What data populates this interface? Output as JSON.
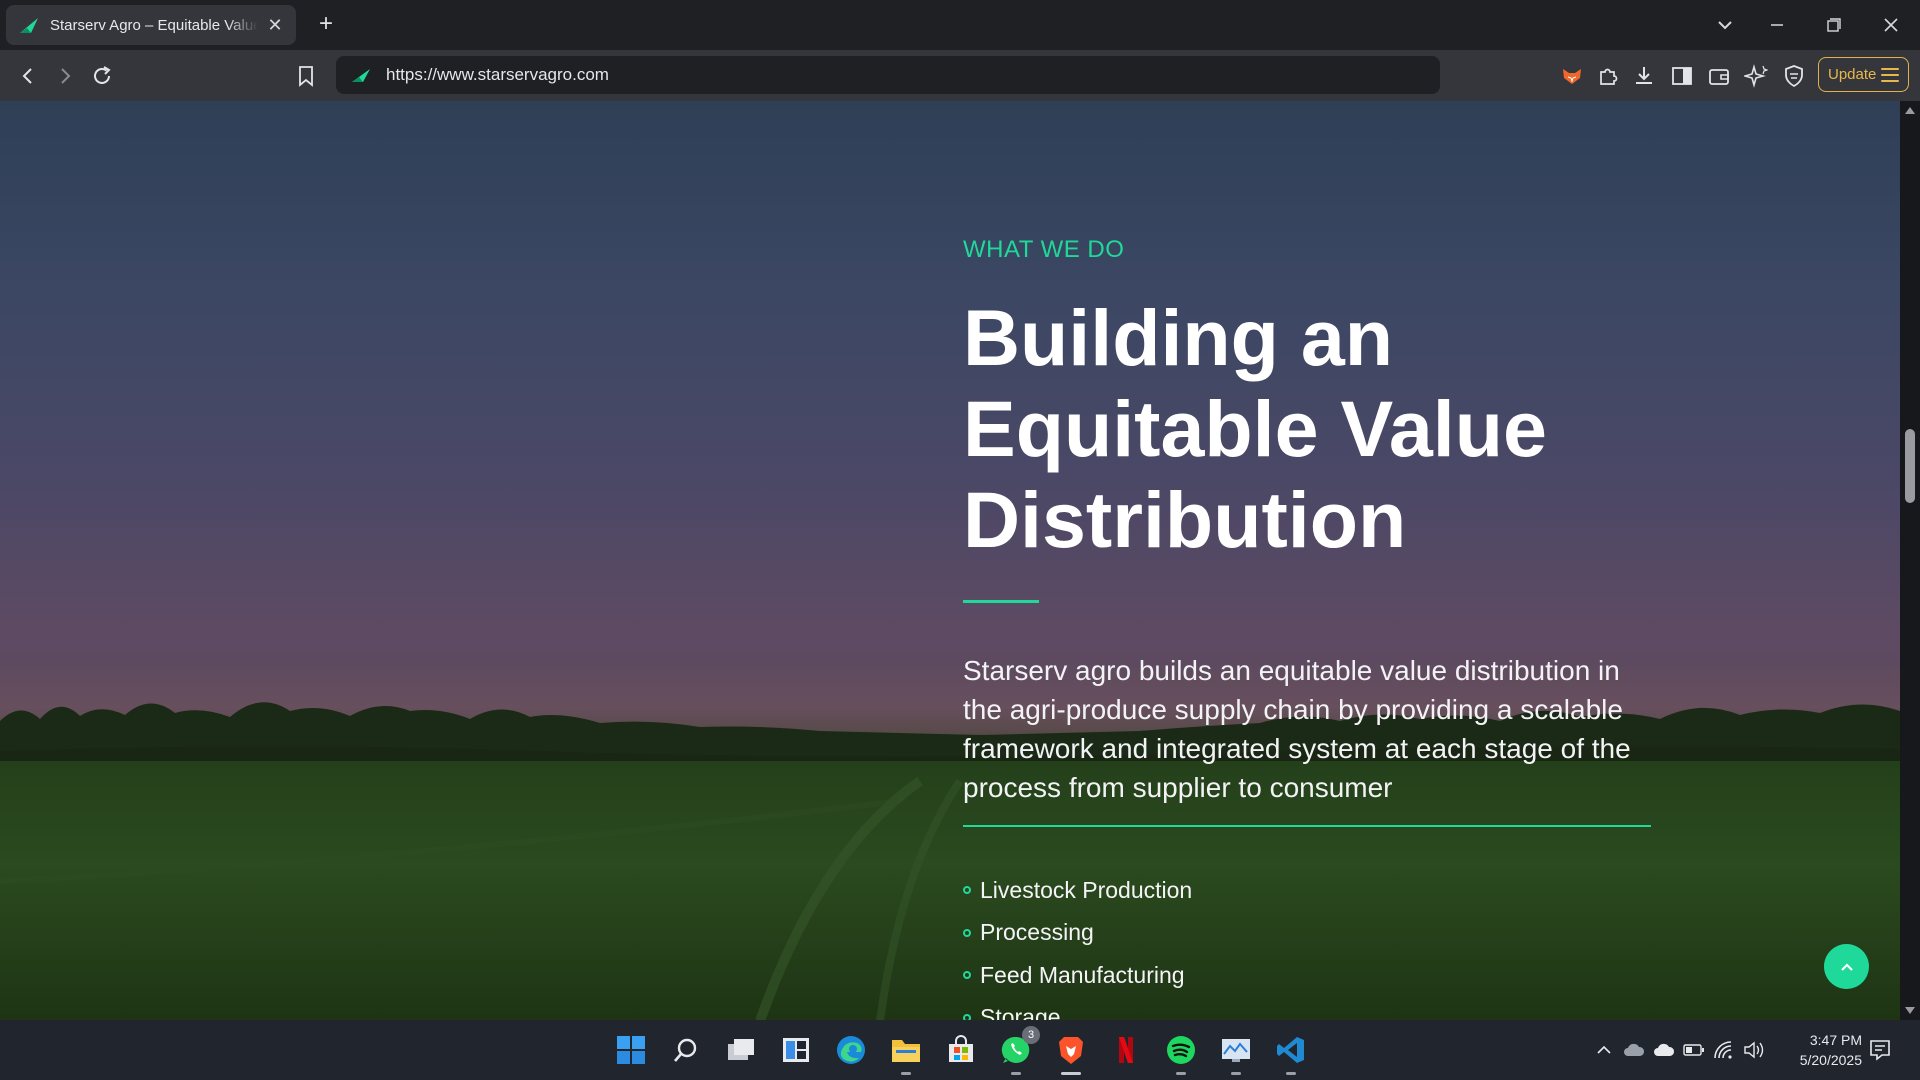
{
  "browser": {
    "tab": {
      "title": "Starserv Agro – Equitable Value",
      "close": "✕"
    },
    "new_tab": "+",
    "url": "https://www.starservagro.com",
    "update_label": "Update"
  },
  "page": {
    "eyebrow": "WHAT WE DO",
    "headline": "Building an Equitable Value Distribution",
    "description": "Starserv agro builds an equitable value distribution in the agri-produce supply chain by providing a scalable framework and integrated system at each stage of the process from supplier to consumer",
    "services": [
      "Livestock Production",
      "Processing",
      "Feed Manufacturing",
      "Storage"
    ]
  },
  "taskbar": {
    "whatsapp_badge": "3",
    "clock_time": "3:47 PM",
    "clock_date": "5/20/2025"
  },
  "colors": {
    "accent": "#1fd99a",
    "update_border": "#e0b34a"
  }
}
